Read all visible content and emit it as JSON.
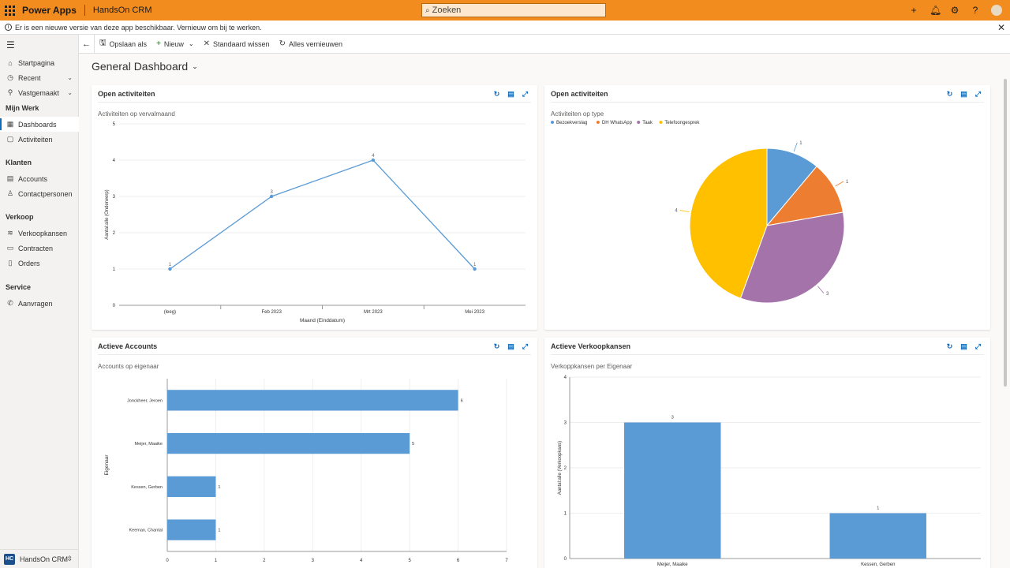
{
  "topbar": {
    "brand": "Power Apps",
    "app_name": "HandsOn CRM",
    "search_placeholder": "Zoeken"
  },
  "notice": {
    "text": "Er is een nieuwe versie van deze app beschikbaar. Vernieuw om bij te werken."
  },
  "sidebar": {
    "items": [
      {
        "label": "Startpagina",
        "icon": "home-icon"
      },
      {
        "label": "Recent",
        "icon": "clock-icon"
      },
      {
        "label": "Vastgemaakt",
        "icon": "pin-icon"
      }
    ],
    "groups": [
      {
        "title": "Mijn Werk",
        "items": [
          {
            "label": "Dashboards",
            "active": true
          },
          {
            "label": "Activiteiten"
          }
        ]
      },
      {
        "title": "Klanten",
        "items": [
          {
            "label": "Accounts"
          },
          {
            "label": "Contactpersonen"
          }
        ]
      },
      {
        "title": "Verkoop",
        "items": [
          {
            "label": "Verkoopkansen"
          },
          {
            "label": "Contracten"
          },
          {
            "label": "Orders"
          }
        ]
      },
      {
        "title": "Service",
        "items": [
          {
            "label": "Aanvragen"
          }
        ]
      }
    ],
    "area": {
      "badge": "HC",
      "label": "HandsOn CRM"
    }
  },
  "commands": {
    "save_as": "Opslaan als",
    "new": "Nieuw",
    "clear_default": "Standaard wissen",
    "refresh_all": "Alles vernieuwen"
  },
  "dashboard": {
    "title": "General Dashboard"
  },
  "cards": [
    {
      "header": "Open activiteiten",
      "chart_title": "Activiteiten op vervalmaand"
    },
    {
      "header": "Open activiteiten",
      "chart_title": "Activiteiten op type"
    },
    {
      "header": "Actieve Accounts",
      "chart_title": "Accounts op eigenaar"
    },
    {
      "header": "Actieve Verkoopkansen",
      "chart_title": "Verkoppkansen per Eigenaar"
    }
  ],
  "colors": {
    "topbar": "#f28c1e",
    "series_blue": "#5b9bd5",
    "line_blue": "#5b9bd5",
    "pie": [
      "#5b9bd5",
      "#ed7d31",
      "#a473aa",
      "#ffc000"
    ]
  },
  "chart_data": [
    {
      "type": "line",
      "categories": [
        "(leeg)",
        "Feb 2023",
        "Mrt 2023",
        "Mei 2023"
      ],
      "values": [
        1,
        3,
        4,
        1
      ],
      "xlabel": "Maand (Einddatum)",
      "ylabel": "Aantal:alle (Onderwerp)",
      "ylim": [
        0,
        5
      ],
      "yticks": [
        "0",
        "1",
        "2",
        "3",
        "4",
        "5"
      ]
    },
    {
      "type": "pie",
      "labels": [
        "Bezoekverslag",
        "DH WhatsApp",
        "Taak",
        "Telefoongesprek"
      ],
      "values": [
        1,
        1,
        3,
        4
      ],
      "legend": "top-left"
    },
    {
      "type": "bar",
      "orientation": "horizontal",
      "categories": [
        "Jonckheer, Jeroen",
        "Meijer, Maaike",
        "Kessen, Gerben",
        "Keeman, Chantal"
      ],
      "values": [
        6,
        5,
        1,
        1
      ],
      "ylabel": "Eigenaar",
      "xlim": [
        0,
        7
      ],
      "xticks": [
        "0",
        "1",
        "2",
        "3",
        "4",
        "5",
        "6",
        "7"
      ]
    },
    {
      "type": "bar",
      "categories": [
        "Meijer, Maaike",
        "Kessen, Gerben"
      ],
      "values": [
        3,
        1
      ],
      "ylabel": "Aantal:alle (Verkoopkans)",
      "ylim": [
        0,
        4
      ],
      "yticks": [
        "0",
        "1",
        "2",
        "3",
        "4"
      ]
    }
  ]
}
